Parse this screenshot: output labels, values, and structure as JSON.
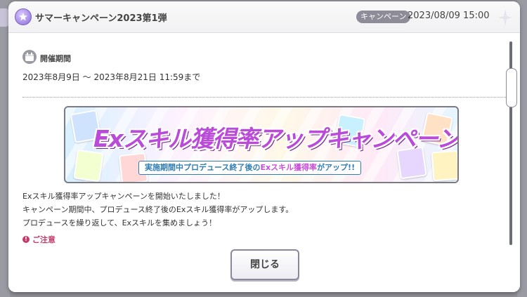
{
  "header": {
    "title": "サマーキャンペーン2023第1弾",
    "badge": "キャンペーン",
    "datetime": "2023/08/09 15:00"
  },
  "period_section": {
    "title": "開催期間",
    "value": "2023年8月9日 〜 2023年8月21日 11:59まで"
  },
  "banner": {
    "title": "Exスキル獲得率アップキャンペーン!",
    "subtitle_pre": "実施期間中プロデュース終了後の",
    "subtitle_hl": "Exスキル獲得率",
    "subtitle_post": "がアップ!!"
  },
  "description": {
    "lines": [
      "Exスキル獲得率アップキャンペーンを開始いたしました！",
      "キャンペーン期間中、プロデュース終了後のExスキル獲得率がアップします。",
      "プロデュースを繰り返して、Exスキルを集めましょう！"
    ],
    "caution": "ご注意"
  },
  "close_button": {
    "label": "閉じる"
  },
  "scroll": {
    "position_fraction": 0.2
  },
  "colors": {
    "accent": "#b94bd8",
    "badge": "#8f8c99",
    "caution": "#c23b6b"
  },
  "icons": [
    "campaign-icon",
    "sparkle-icon",
    "calendar-icon",
    "caution-icon"
  ]
}
